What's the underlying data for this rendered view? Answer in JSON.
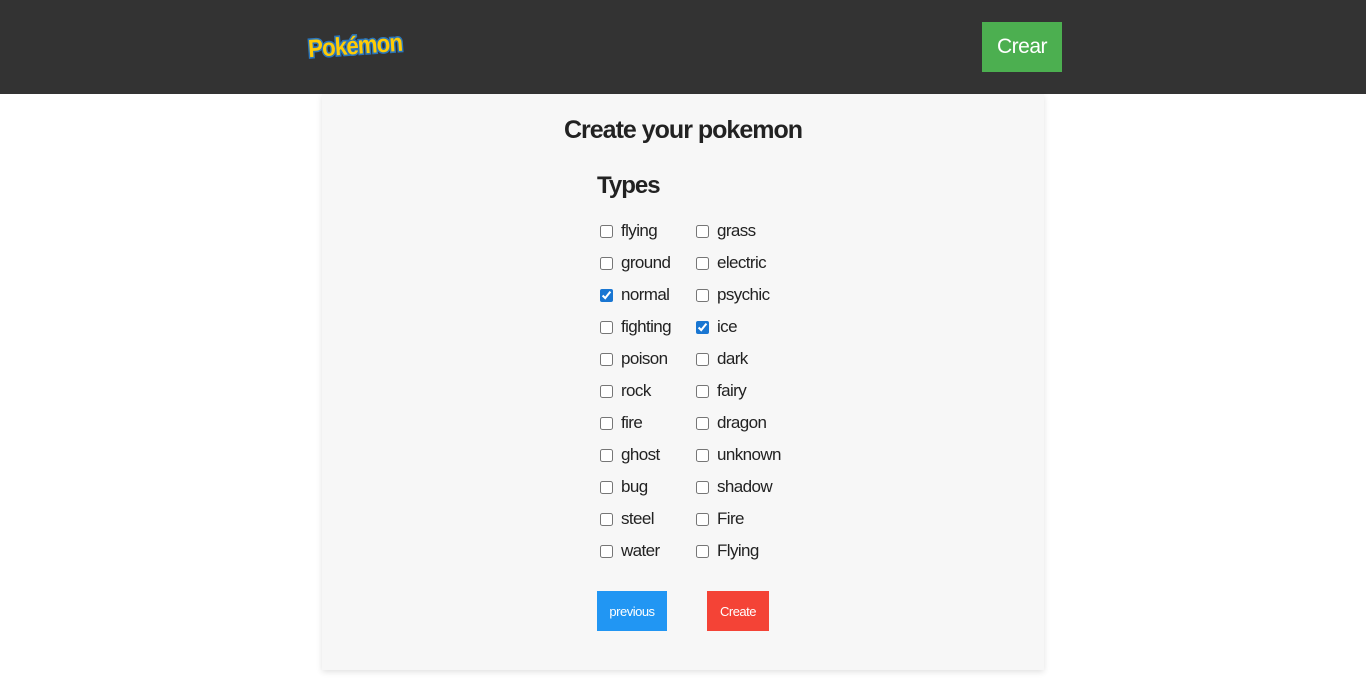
{
  "navbar": {
    "logo_text": "Pokémon",
    "create_button": "Crear",
    "colors": {
      "background": "#333333",
      "button": "#4caf50"
    }
  },
  "form": {
    "title": "Create your pokemon",
    "section_title": "Types",
    "types": [
      {
        "label": "flying",
        "checked": false
      },
      {
        "label": "grass",
        "checked": false
      },
      {
        "label": "ground",
        "checked": false
      },
      {
        "label": "electric",
        "checked": false
      },
      {
        "label": "normal",
        "checked": true
      },
      {
        "label": "psychic",
        "checked": false
      },
      {
        "label": "fighting",
        "checked": false
      },
      {
        "label": "ice",
        "checked": true
      },
      {
        "label": "poison",
        "checked": false
      },
      {
        "label": "dark",
        "checked": false
      },
      {
        "label": "rock",
        "checked": false
      },
      {
        "label": "fairy",
        "checked": false
      },
      {
        "label": "fire",
        "checked": false
      },
      {
        "label": "dragon",
        "checked": false
      },
      {
        "label": "ghost",
        "checked": false
      },
      {
        "label": "unknown",
        "checked": false
      },
      {
        "label": "bug",
        "checked": false
      },
      {
        "label": "shadow",
        "checked": false
      },
      {
        "label": "steel",
        "checked": false
      },
      {
        "label": "Fire",
        "checked": false
      },
      {
        "label": "water",
        "checked": false
      },
      {
        "label": "Flying",
        "checked": false
      }
    ],
    "previous_button": "previous",
    "create_button": "Create",
    "colors": {
      "card": "#f7f7f7",
      "previous": "#2196f3",
      "create": "#f44336"
    }
  }
}
